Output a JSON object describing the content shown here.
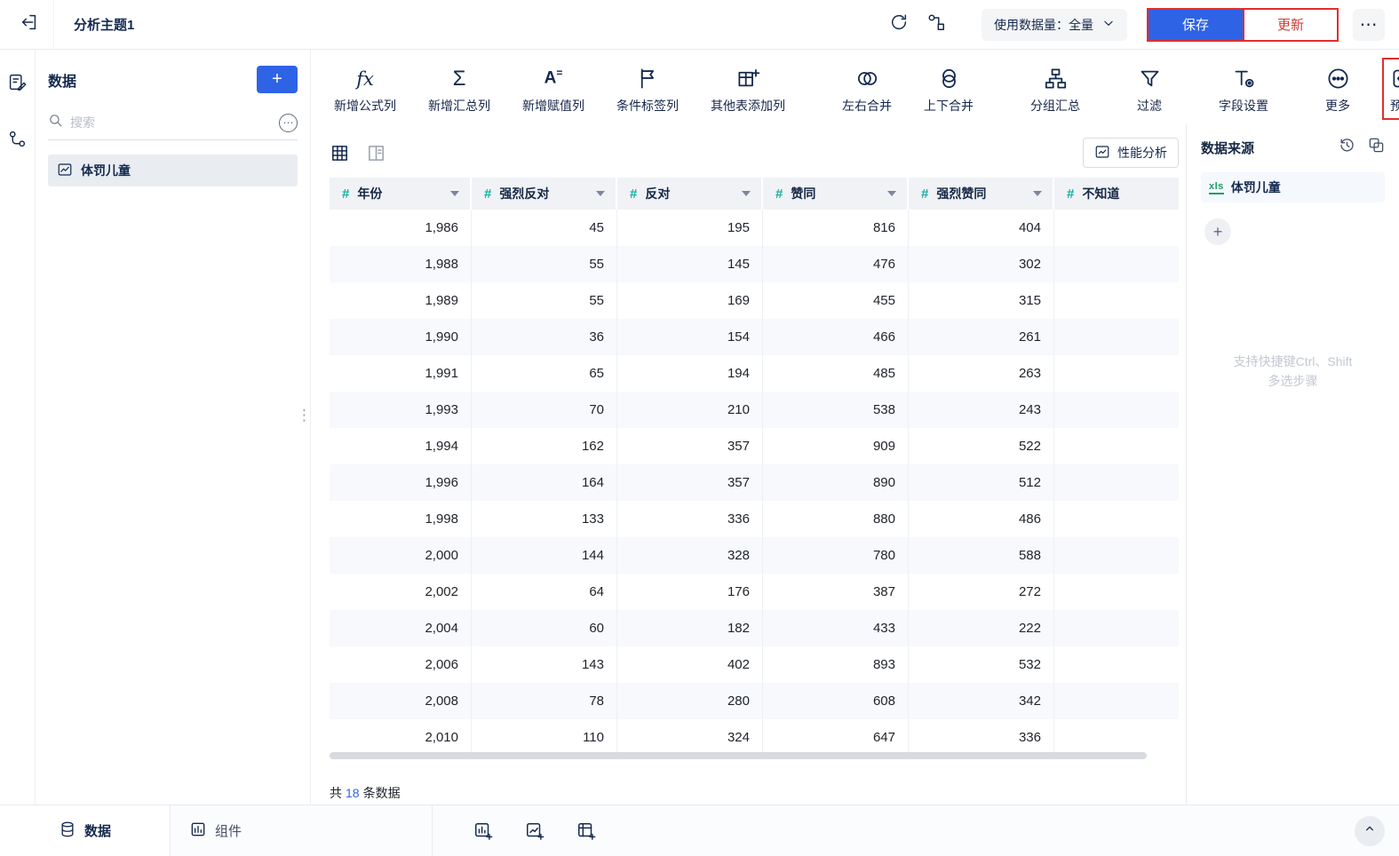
{
  "header": {
    "title": "分析主题1",
    "data_volume": "使用数据量：全量",
    "save": "保存",
    "update": "更新",
    "more": "⋯"
  },
  "sidebar": {
    "title": "数据",
    "search_placeholder": "搜索",
    "items": [
      {
        "label": "体罚儿童"
      }
    ]
  },
  "toolbar": {
    "items": [
      {
        "name": "formula-column",
        "icon": "fx-icon",
        "label": "新增公式列"
      },
      {
        "name": "summary-column",
        "icon": "sigma-icon",
        "label": "新增汇总列"
      },
      {
        "name": "assign-column",
        "icon": "assign-icon",
        "label": "新增赋值列"
      },
      {
        "name": "condition-tag-column",
        "icon": "flag-icon",
        "label": "条件标签列"
      },
      {
        "name": "other-table-column",
        "icon": "table-plus-icon",
        "label": "其他表添加列"
      },
      {
        "name": "merge-left-right",
        "icon": "venn-horizontal-icon",
        "label": "左右合并"
      },
      {
        "name": "merge-top-bottom",
        "icon": "venn-vertical-icon",
        "label": "上下合并"
      },
      {
        "name": "group-summary",
        "icon": "hierarchy-icon",
        "label": "分组汇总"
      },
      {
        "name": "filter",
        "icon": "funnel-icon",
        "label": "过滤"
      },
      {
        "name": "field-settings",
        "icon": "field-gear-icon",
        "label": "字段设置"
      },
      {
        "name": "more",
        "icon": "ellipsis-circle-icon",
        "label": "更多"
      },
      {
        "name": "preview",
        "icon": "eye-icon",
        "label": "预览"
      }
    ]
  },
  "table": {
    "performance": "性能分析",
    "columns": [
      "年份",
      "强烈反对",
      "反对",
      "赞同",
      "强烈赞同",
      "不知道"
    ],
    "rows": [
      [
        "1,986",
        "45",
        "195",
        "816",
        "404",
        ""
      ],
      [
        "1,988",
        "55",
        "145",
        "476",
        "302",
        ""
      ],
      [
        "1,989",
        "55",
        "169",
        "455",
        "315",
        ""
      ],
      [
        "1,990",
        "36",
        "154",
        "466",
        "261",
        ""
      ],
      [
        "1,991",
        "65",
        "194",
        "485",
        "263",
        ""
      ],
      [
        "1,993",
        "70",
        "210",
        "538",
        "243",
        ""
      ],
      [
        "1,994",
        "162",
        "357",
        "909",
        "522",
        ""
      ],
      [
        "1,996",
        "164",
        "357",
        "890",
        "512",
        ""
      ],
      [
        "1,998",
        "133",
        "336",
        "880",
        "486",
        ""
      ],
      [
        "2,000",
        "144",
        "328",
        "780",
        "588",
        ""
      ],
      [
        "2,002",
        "64",
        "176",
        "387",
        "272",
        ""
      ],
      [
        "2,004",
        "60",
        "182",
        "433",
        "222",
        ""
      ],
      [
        "2,006",
        "143",
        "402",
        "893",
        "532",
        ""
      ],
      [
        "2,008",
        "78",
        "280",
        "608",
        "342",
        ""
      ],
      [
        "2,010",
        "110",
        "324",
        "647",
        "336",
        ""
      ]
    ],
    "footer_prefix": "共",
    "footer_count": "18",
    "footer_suffix": "条数据"
  },
  "right_panel": {
    "title": "数据来源",
    "source_type": "xls",
    "source_label": "体罚儿童",
    "hint_line1": "支持快捷键Ctrl、Shift",
    "hint_line2": "多选步骤"
  },
  "bottom_bar": {
    "tabs": [
      {
        "label": "数据"
      },
      {
        "label": "组件"
      }
    ]
  },
  "colors": {
    "primary_blue": "#2e63e6",
    "field_teal": "#12b3a3",
    "annotation_red": "#e12e2e",
    "excel_green": "#1a9e5f"
  }
}
